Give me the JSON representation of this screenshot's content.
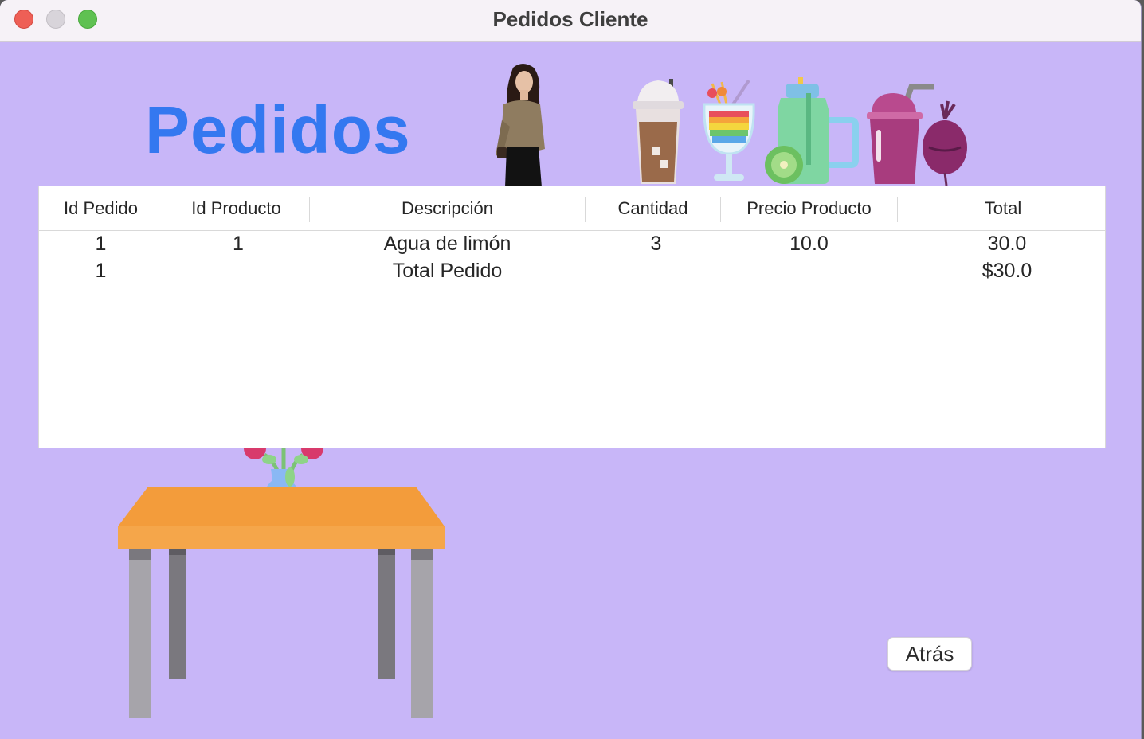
{
  "window": {
    "title": "Pedidos Cliente"
  },
  "page": {
    "heading": "Pedidos"
  },
  "table": {
    "columns": [
      "Id Pedido",
      "Id Producto",
      "Descripción",
      "Cantidad",
      "Precio Producto",
      "Total"
    ],
    "rows": [
      [
        "1",
        "1",
        "Agua de limón",
        "3",
        "10.0",
        "30.0"
      ],
      [
        "1",
        "",
        "Total Pedido",
        "",
        "",
        "$30.0"
      ]
    ]
  },
  "buttons": {
    "back_label": "Atrás"
  },
  "colors": {
    "background": "#c8b6f8",
    "heading": "#3478f0",
    "table_orange": "#f39c3b"
  }
}
